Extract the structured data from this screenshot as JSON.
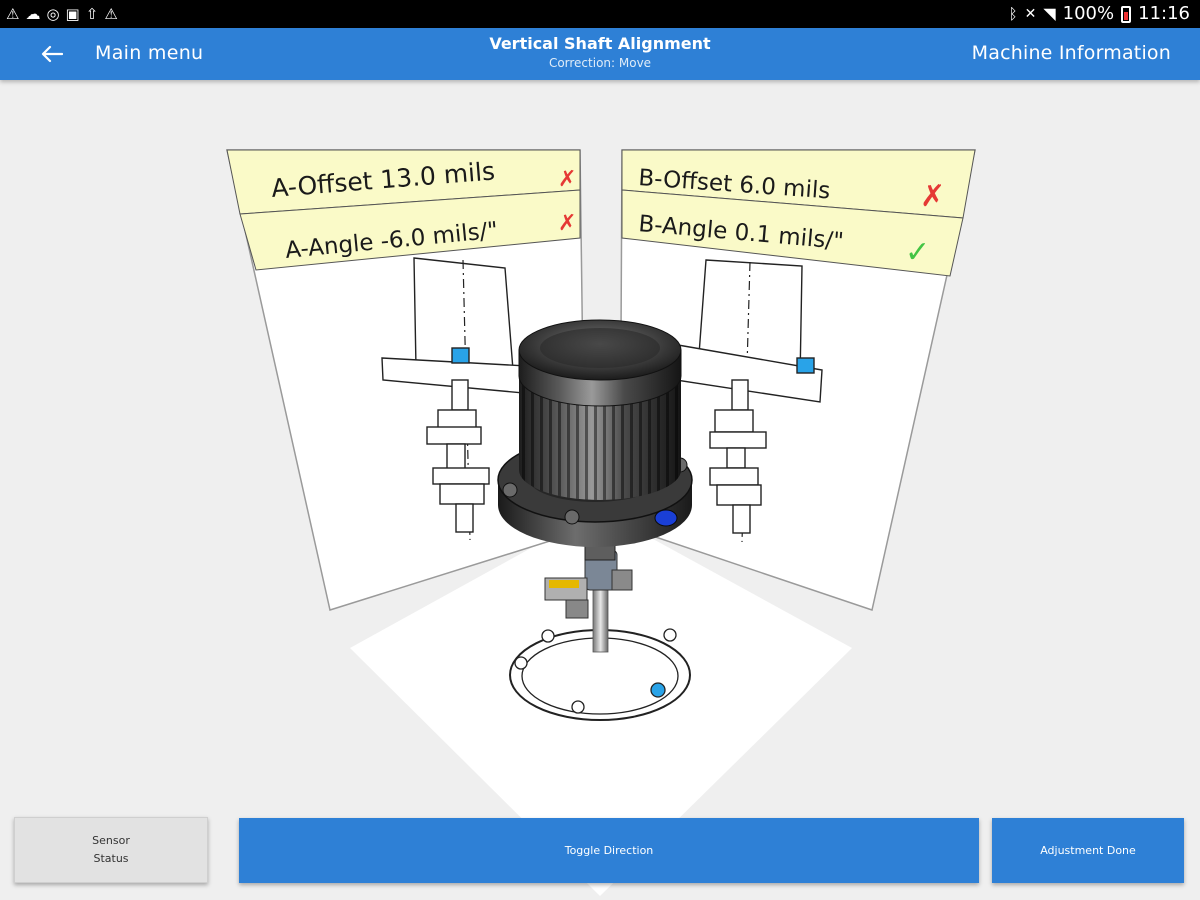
{
  "status_bar": {
    "battery": "100%",
    "time": "11:16",
    "left_icons": [
      "warning-icon",
      "cloud-icon",
      "globe-icon",
      "image-icon",
      "upload-icon",
      "warning-icon"
    ],
    "right_icons": [
      "bluetooth-icon",
      "mute-icon",
      "wifi-icon",
      "battery-icon"
    ]
  },
  "header": {
    "back_label": "Main menu",
    "title": "Vertical Shaft Alignment",
    "subtitle": "Correction: Move",
    "right_label": "Machine Information",
    "color": "#2e80d6"
  },
  "panels": {
    "a": {
      "offset": "A-Offset 13.0 mils",
      "angle": "A-Angle -6.0 mils/\"",
      "offset_status": "✗",
      "angle_status": "✗"
    },
    "b": {
      "offset": "B-Offset 6.0 mils",
      "angle": "B-Angle 0.1 mils/\"",
      "offset_status": "✗",
      "angle_status": "✓"
    }
  },
  "colors": {
    "fail": "#e53935",
    "pass": "#43c443",
    "label_bg": "#fafac8",
    "sensor": "#29a3e8"
  },
  "buttons": {
    "sensor_status": "Sensor\nStatus",
    "toggle_direction": "Toggle Direction",
    "adjustment_done": "Adjustment Done"
  }
}
